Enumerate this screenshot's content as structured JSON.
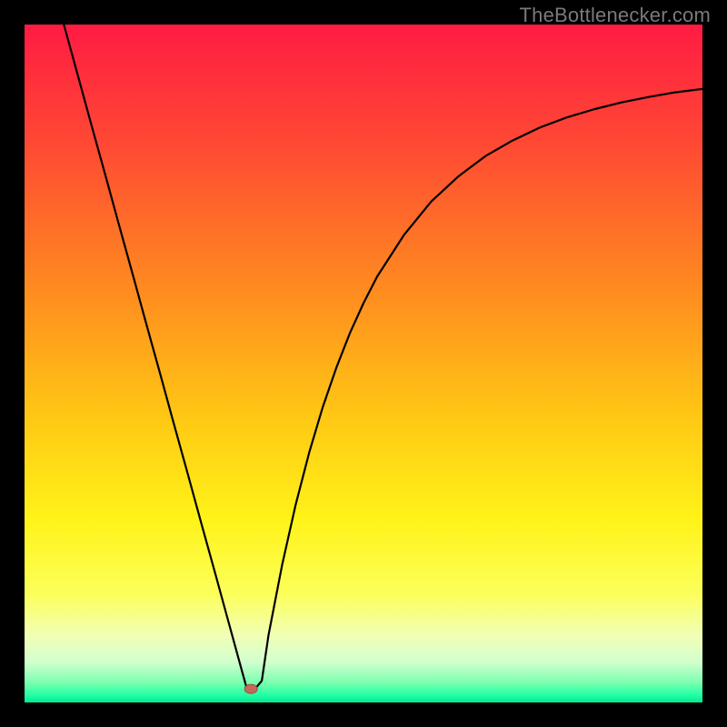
{
  "watermark": "TheBottlenecker.com",
  "gradient_colors": {
    "top": "#ff1b43",
    "upper_mid": "#ff8e1f",
    "mid": "#fff318",
    "lower": "#1fffa5",
    "bottom": "#00e88f"
  },
  "curve_color": "#000000",
  "marker_color": "#c46a5a",
  "chart_data": {
    "type": "line",
    "title": "",
    "xlabel": "",
    "ylabel": "",
    "xlim": [
      0,
      100
    ],
    "ylim": [
      0,
      100
    ],
    "x": [
      5.8,
      8,
      10,
      12,
      14,
      16,
      18,
      20,
      22,
      24,
      26,
      28,
      30,
      32,
      32.8,
      34,
      35,
      36,
      38,
      40,
      42,
      44,
      46,
      48,
      50,
      52,
      56,
      60,
      64,
      68,
      72,
      76,
      80,
      84,
      88,
      92,
      96,
      100
    ],
    "y": [
      100,
      92,
      84.7,
      77.5,
      70.2,
      63,
      55.7,
      48.5,
      41.2,
      34,
      26.7,
      19.5,
      12.2,
      4.9,
      2,
      2,
      3.2,
      10,
      20.3,
      29.2,
      36.9,
      43.6,
      49.4,
      54.5,
      58.9,
      62.8,
      69,
      73.9,
      77.6,
      80.6,
      82.9,
      84.8,
      86.3,
      87.5,
      88.5,
      89.3,
      90,
      90.5
    ],
    "optimal_point": {
      "x": 33.4,
      "y": 2
    }
  }
}
